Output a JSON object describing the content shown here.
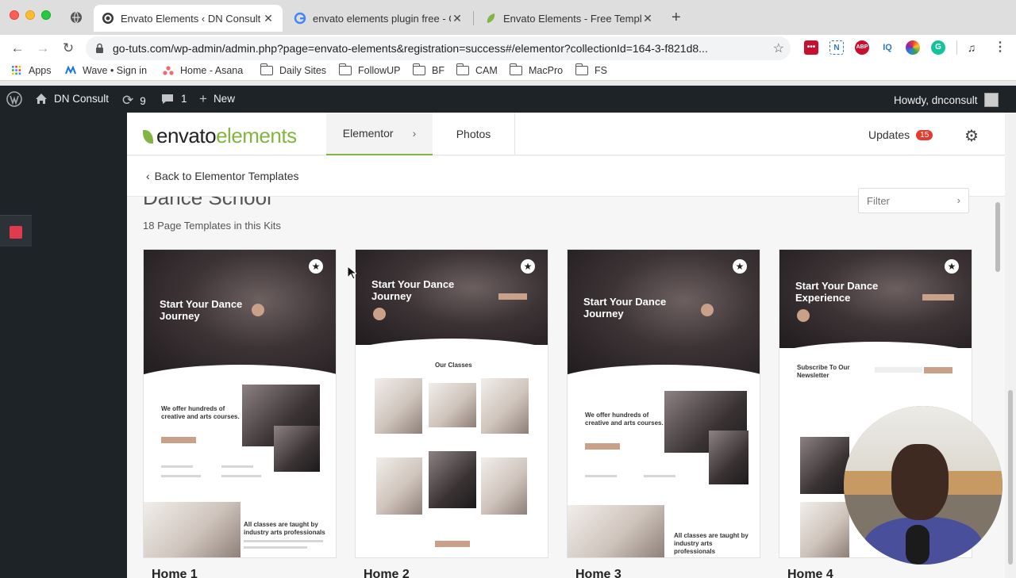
{
  "browser": {
    "tabs": [
      {
        "title": "Envato Elements ‹ DN Consult",
        "active": true
      },
      {
        "title": "envato elements plugin free - G",
        "active": false
      },
      {
        "title": "Envato Elements - Free Templa",
        "active": false
      }
    ],
    "url": "go-tuts.com/wp-admin/admin.php?page=envato-elements&registration=success#/elementor?collectionId=164-3-f821d8...",
    "extensions": [
      "ABP",
      "IQ"
    ]
  },
  "bookmarks": [
    {
      "label": "Apps",
      "icon": "apps-grid-icon"
    },
    {
      "label": "Wave • Sign in",
      "icon": "wave-icon"
    },
    {
      "label": "Home - Asana",
      "icon": "asana-icon"
    },
    {
      "label": "Daily Sites",
      "icon": "folder-icon"
    },
    {
      "label": "FollowUP",
      "icon": "folder-icon"
    },
    {
      "label": "BF",
      "icon": "folder-icon"
    },
    {
      "label": "CAM",
      "icon": "folder-icon"
    },
    {
      "label": "MacPro",
      "icon": "folder-icon"
    },
    {
      "label": "FS",
      "icon": "folder-icon"
    }
  ],
  "adminbar": {
    "site_name": "DN Consult",
    "updates_count": "9",
    "comments_count": "1",
    "new_label": "New",
    "howdy": "Howdy, dnconsult"
  },
  "envato": {
    "logo_text_a": "envato",
    "logo_text_b": "elements",
    "tabs": [
      {
        "label": "Elementor",
        "active": true
      },
      {
        "label": "Photos",
        "active": false
      }
    ],
    "updates_label": "Updates",
    "updates_badge": "15",
    "back_link": "Back to Elementor Templates",
    "kit_title": "Dance School",
    "kit_count": "18 Page Templates in this Kits",
    "filter_label": "Filter",
    "cards": [
      {
        "name": "Home 1",
        "hero": "Start Your Dance Journey",
        "section": "We offer hundreds of creative and arts courses.",
        "footer": "All classes are taught by industry arts professionals"
      },
      {
        "name": "Home 2",
        "hero": "Start Your Dance Journey",
        "section": "Our Classes"
      },
      {
        "name": "Home 3",
        "hero": "Start Your Dance Journey",
        "section": "We offer hundreds of creative and arts courses.",
        "footer": "All classes are taught by industry arts professionals"
      },
      {
        "name": "Home 4",
        "hero": "Start Your Dance Experience",
        "section": "Subscribe To Our Newsletter"
      }
    ]
  },
  "colors": {
    "envato_green": "#82b541",
    "accent_tan": "#c9a088",
    "wp_dark": "#1d2327",
    "badge_red": "#e43b2f"
  }
}
